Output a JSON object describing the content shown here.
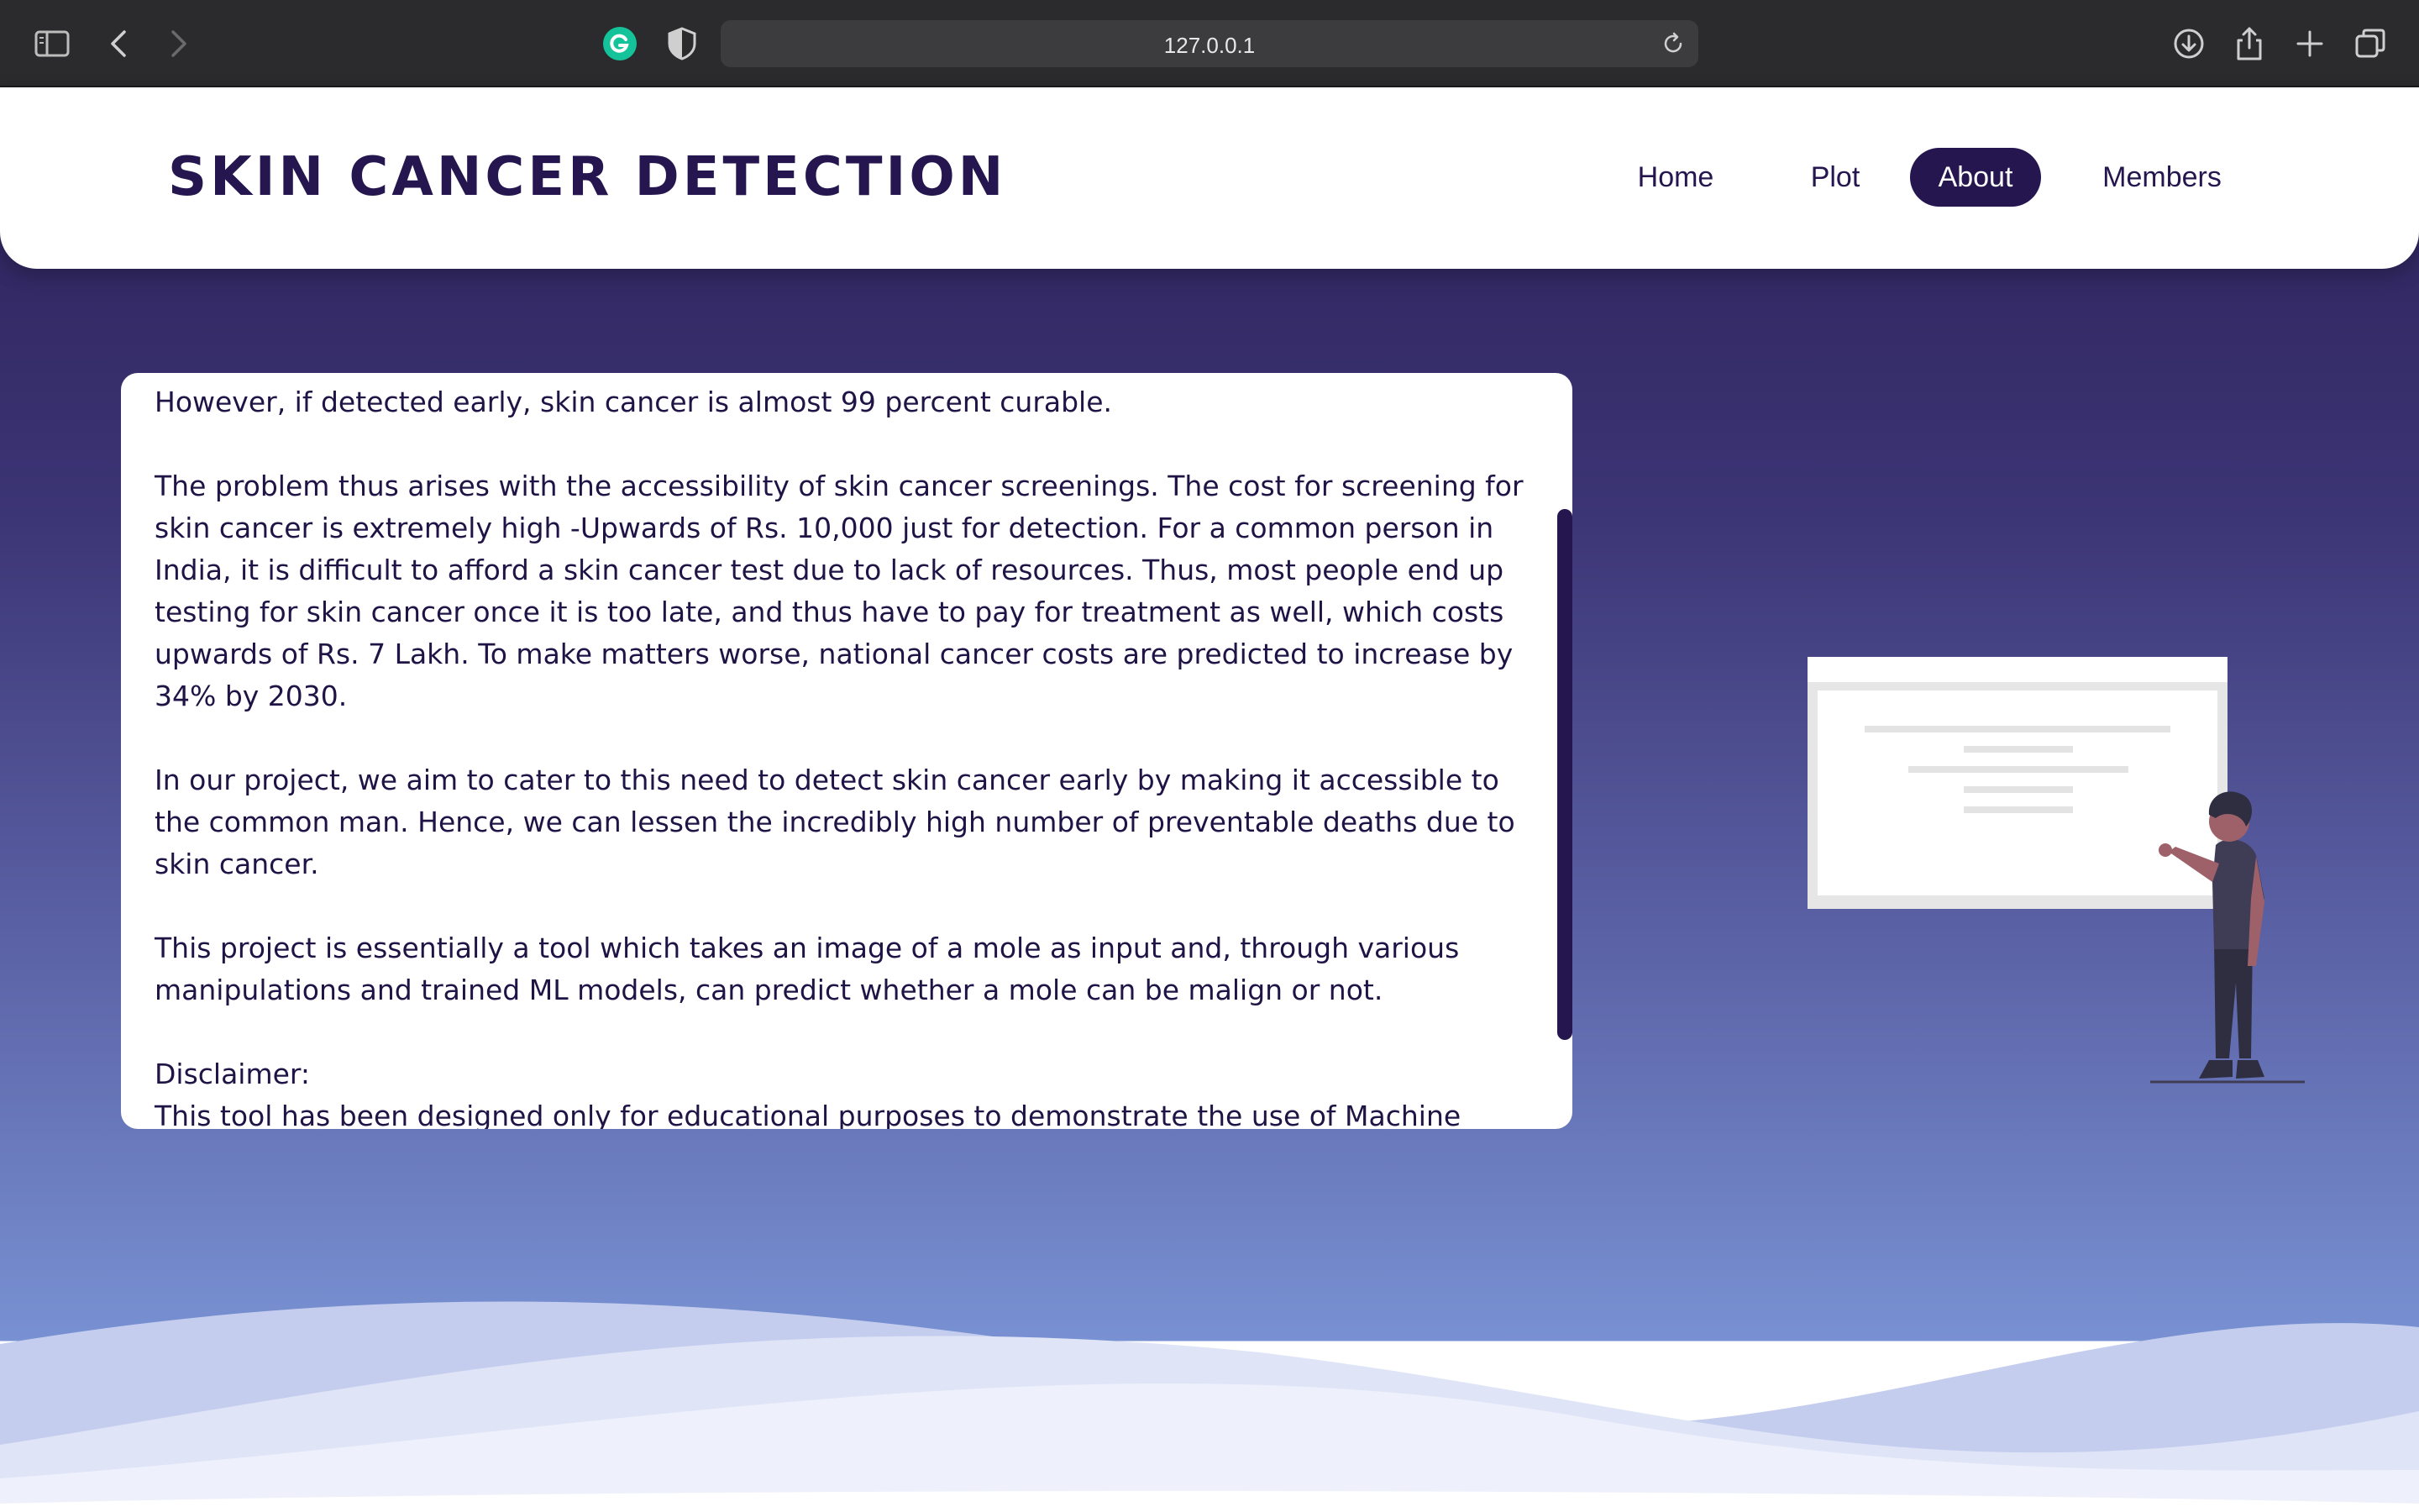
{
  "browser": {
    "url": "127.0.0.1"
  },
  "header": {
    "title": "SKIN CANCER DETECTION",
    "nav": [
      {
        "label": "Home",
        "active": false
      },
      {
        "label": "Plot",
        "active": false
      },
      {
        "label": "About",
        "active": true
      },
      {
        "label": "Members",
        "active": false
      }
    ]
  },
  "content": {
    "paragraphs": [
      "However, if detected early, skin cancer is almost 99 percent curable.",
      "The problem thus arises with the accessibility of skin cancer screenings. The cost for screening for skin cancer is extremely high -Upwards of Rs. 10,000 just for detection. For a common person in India, it is difficult to afford a skin cancer test due to lack of resources. Thus, most people end up testing for skin cancer once it is too late, and thus have to pay for treatment as well, which costs upwards of Rs. 7 Lakh. To make matters worse, national cancer costs are predicted to increase by 34% by 2030.",
      "In our project, we aim to cater to this need to detect skin cancer early by making it accessible to the common man. Hence, we can lessen the incredibly high number of preventable deaths due to skin cancer.",
      "This project is essentially a tool which takes an image of a mole as input and, through various manipulations and trained ML models, can predict whether a mole can be malign or not."
    ],
    "disclaimer_heading": "Disclaimer:",
    "disclaimer_text": "This tool has been designed only for educational purposes to demonstrate the use of Machine Learning tools in the medical field. This tool does not replace advice or evaluation by a medical"
  },
  "colors": {
    "brand": "#25164f",
    "gradient_top": "#2c2058",
    "gradient_bottom": "#7891d2"
  }
}
